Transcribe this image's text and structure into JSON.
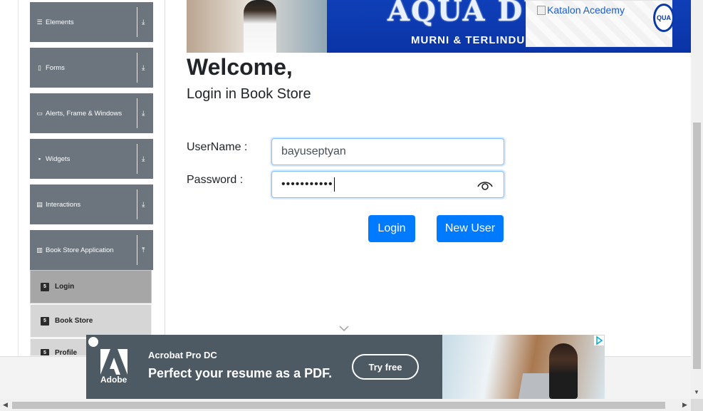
{
  "sidebar": {
    "groups": [
      {
        "label": "Elements",
        "icon": "hamburger-icon"
      },
      {
        "label": "Forms",
        "icon": "form-icon"
      },
      {
        "label": "Alerts, Frame & Windows",
        "icon": "window-icon"
      },
      {
        "label": "Widgets",
        "icon": "grid-icon"
      },
      {
        "label": "Interactions",
        "icon": "list-icon"
      },
      {
        "label": "Book Store Application",
        "icon": "books-icon"
      }
    ],
    "book_store_items": [
      {
        "label": "Login",
        "active": true
      },
      {
        "label": "Book Store",
        "active": false
      },
      {
        "label": "Profile",
        "active": false
      }
    ]
  },
  "banner": {
    "brand_text": "AQUA DU",
    "tagline": "MURNI & TERLINDU",
    "ad_alt_text": "Katalon Acedemy",
    "ad_logo_text": "QUA"
  },
  "main": {
    "title": "Welcome,",
    "subtitle": "Login in Book Store",
    "username_label": "UserName :",
    "username_value": "bayuseptyan",
    "password_label": "Password :",
    "password_masked": "•••••••••••",
    "login_button": "Login",
    "new_user_button": "New User"
  },
  "ad": {
    "brand": "Adobe",
    "product": "Acrobat Pro DC",
    "headline": "Perfect your resume as a PDF.",
    "cta": "Try free"
  },
  "colors": {
    "sidebar_group_bg": "#6c757d",
    "primary_button": "#007bff",
    "banner_blue": "#0a34a6",
    "ad_bg": "#4d5963"
  }
}
